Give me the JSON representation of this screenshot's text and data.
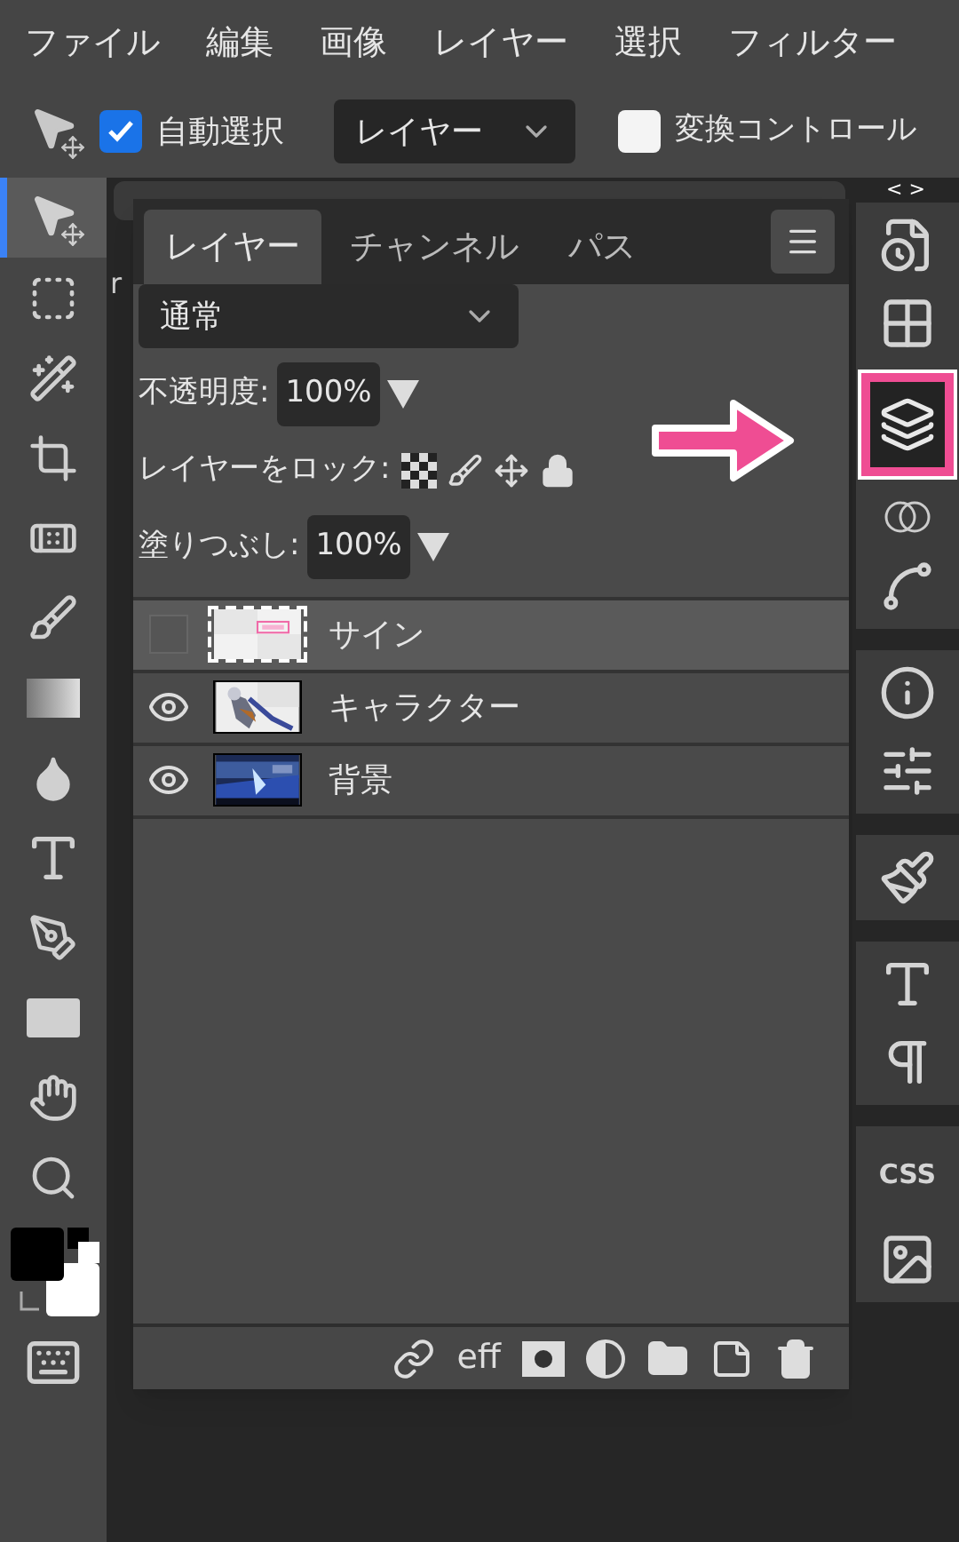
{
  "menu": [
    "ファイル",
    "編集",
    "画像",
    "レイヤー",
    "選択",
    "フィルター"
  ],
  "options": {
    "auto_select": {
      "label": "自動選択",
      "checked": true
    },
    "target": "レイヤー",
    "transform_controls": {
      "label": "変換コントロール",
      "checked": false
    }
  },
  "tools": [
    {
      "selected": true
    },
    {
      "selected": false
    },
    {
      "selected": false
    },
    {
      "selected": false
    },
    {
      "selected": false
    },
    {
      "selected": false
    },
    {
      "selected": false
    },
    {
      "selected": false
    },
    {
      "selected": false
    },
    {
      "selected": false
    },
    {
      "selected": false
    },
    {
      "selected": false
    },
    {
      "selected": false
    }
  ],
  "document": {
    "tab_text": "r"
  },
  "layers_panel": {
    "tabs": [
      {
        "label": "レイヤー",
        "selected": true
      },
      {
        "label": "チャンネル",
        "selected": false
      },
      {
        "label": "パス",
        "selected": false
      }
    ],
    "blend_mode": "通常",
    "opacity_label": "不透明度:",
    "opacity": "100%",
    "lock_label": "レイヤーをロック:",
    "fill_label": "塗りつぶし:",
    "fill": "100%",
    "layers": [
      {
        "name": "サイン",
        "visible": false,
        "selected": true
      },
      {
        "name": "キャラクター",
        "visible": true,
        "selected": false
      },
      {
        "name": "背景",
        "visible": true,
        "selected": false
      }
    ],
    "effects_label": "eff"
  },
  "right_panel": {
    "toggle": "< >",
    "layers_selected": true,
    "css_label": "CSS"
  }
}
